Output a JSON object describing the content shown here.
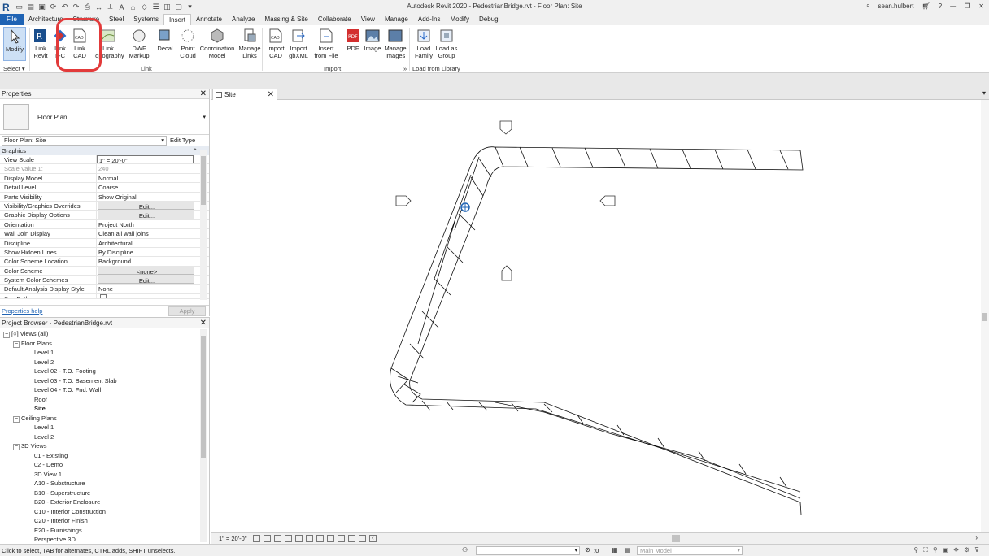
{
  "window_title": "Autodesk Revit 2020 - PedestrianBridge.rvt - Floor Plan: Site",
  "user": "sean.hulbert",
  "tabs": [
    "File",
    "Architecture",
    "Structure",
    "Steel",
    "Systems",
    "Insert",
    "Annotate",
    "Analyze",
    "Massing & Site",
    "Collaborate",
    "View",
    "Manage",
    "Add-Ins",
    "Modify",
    "Debug"
  ],
  "active_tab": "Insert",
  "ribbon": {
    "modify": "Modify",
    "select": "Select ▾",
    "link_revit": "Link\nRevit",
    "link_ifc": "Link\nIFC",
    "link_cad": "Link\nCAD",
    "link_topography": "Link\nTopography",
    "dwf_markup": "DWF\nMarkup",
    "decal": "Decal",
    "point_cloud": "Point\nCloud",
    "coordination_model": "Coordination\nModel",
    "manage_links": "Manage\nLinks",
    "import_cad": "Import\nCAD",
    "import_gbxml": "Import\ngbXML",
    "insert_from_file": "Insert\nfrom File",
    "pdf": "PDF",
    "image": "Image",
    "manage_images": "Manage\nImages",
    "load_family": "Load\nFamily",
    "load_as_group": "Load as\nGroup",
    "group_link": "Link",
    "group_import": "Import",
    "group_load": "Load from Library"
  },
  "properties": {
    "title": "Properties",
    "type_name": "Floor Plan",
    "view_selector": "Floor Plan: Site",
    "edit_type": "Edit Type",
    "group": "Graphics",
    "rows": [
      {
        "name": "View Scale",
        "value": "1\" = 20'-0\""
      },
      {
        "name": "Scale Value    1:",
        "value": "240"
      },
      {
        "name": "Display Model",
        "value": "Normal"
      },
      {
        "name": "Detail Level",
        "value": "Coarse"
      },
      {
        "name": "Parts Visibility",
        "value": "Show Original"
      },
      {
        "name": "Visibility/Graphics Overrides",
        "value": "Edit..."
      },
      {
        "name": "Graphic Display Options",
        "value": "Edit..."
      },
      {
        "name": "Orientation",
        "value": "Project North"
      },
      {
        "name": "Wall Join Display",
        "value": "Clean all wall joins"
      },
      {
        "name": "Discipline",
        "value": "Architectural"
      },
      {
        "name": "Show Hidden Lines",
        "value": "By Discipline"
      },
      {
        "name": "Color Scheme Location",
        "value": "Background"
      },
      {
        "name": "Color Scheme",
        "value": "<none>"
      },
      {
        "name": "System Color Schemes",
        "value": "Edit..."
      },
      {
        "name": "Default Analysis Display Style",
        "value": "None"
      },
      {
        "name": "Sun Path",
        "value": ""
      }
    ],
    "help": "Properties help",
    "apply": "Apply"
  },
  "browser": {
    "title": "Project Browser - PedestrianBridge.rvt",
    "views_all": "Views (all)",
    "floor_plans": "Floor Plans",
    "floor_items": [
      "Level 1",
      "Level 2",
      "Level 02 - T.O. Footing",
      "Level 03 - T.O. Basement Slab",
      "Level 04 - T.O. Fnd. Wall",
      "Roof",
      "Site"
    ],
    "ceiling_plans": "Ceiling Plans",
    "ceiling_items": [
      "Level 1",
      "Level 2"
    ],
    "views_3d": "3D Views",
    "items_3d": [
      "01 - Existing",
      "02 - Demo",
      "3D View 1",
      "A10 - Substructure",
      "B10 - Superstructure",
      "B20 - Exterior Enclosure",
      "C10 - Interior Construction",
      "C20 - Interior Finish",
      "E20 - Furnishings",
      "Perspective 3D"
    ]
  },
  "view_tab": "Site",
  "view_scale": "1\" = 20'-0\"",
  "status": {
    "message": "Click to select, TAB for alternates, CTRL adds, SHIFT unselects.",
    "count": ":0",
    "model": "Main Model"
  }
}
